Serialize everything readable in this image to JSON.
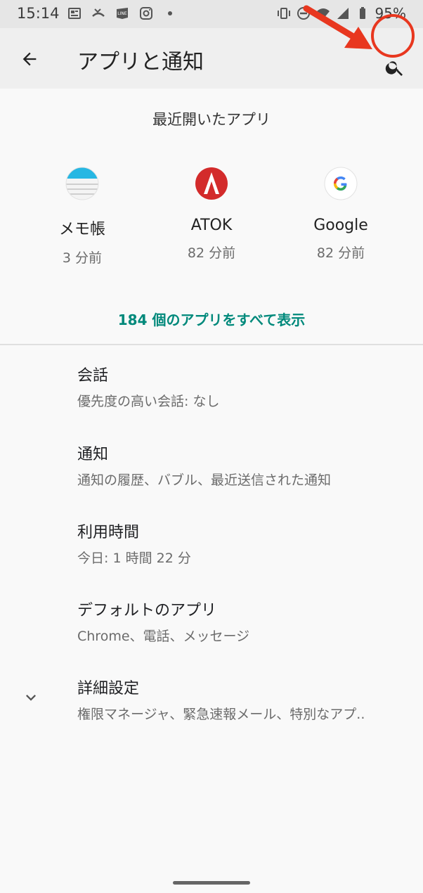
{
  "status": {
    "time": "15:14",
    "battery": "95%"
  },
  "appbar": {
    "title": "アプリと通知"
  },
  "recent": {
    "header": "最近開いたアプリ",
    "apps": [
      {
        "name": "メモ帳",
        "time": "3 分前"
      },
      {
        "name": "ATOK",
        "time": "82 分前"
      },
      {
        "name": "Google",
        "time": "82 分前"
      }
    ],
    "show_all": "184 個のアプリをすべて表示"
  },
  "menu": [
    {
      "title": "会話",
      "sub": "優先度の高い会話: なし"
    },
    {
      "title": "通知",
      "sub": "通知の履歴、バブル、最近送信された通知"
    },
    {
      "title": "利用時間",
      "sub": "今日: 1 時間 22 分"
    },
    {
      "title": "デフォルトのアプリ",
      "sub": "Chrome、電話、メッセージ"
    },
    {
      "title": "詳細設定",
      "sub": "権限マネージャ、緊急速報メール、特別なアプ.."
    }
  ],
  "colors": {
    "accent": "#00897b",
    "annotation": "#e8371f"
  }
}
